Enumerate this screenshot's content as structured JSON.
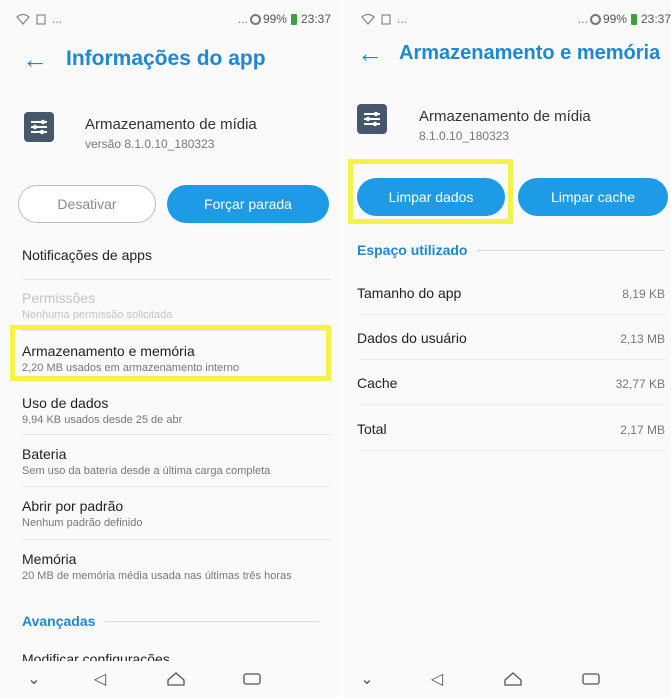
{
  "left": {
    "status": {
      "dots": "...",
      "time": "23:37",
      "battery": "99%"
    },
    "title": "Informações do app",
    "app_name": "Armazenamento de mídia",
    "app_version": "versão 8.1.0.10_180323",
    "buttons": {
      "disable": "Desativar",
      "force_stop": "Forçar parada"
    },
    "items": [
      {
        "title": "Notificações de apps",
        "sub": ""
      },
      {
        "title": "Permissões",
        "sub": "Nenhuma permissão solicitada"
      },
      {
        "title": "Armazenamento e memória",
        "sub": "2,20 MB usados em armazenamento interno"
      },
      {
        "title": "Uso de dados",
        "sub": "9,94 KB usados desde 25 de abr"
      },
      {
        "title": "Bateria",
        "sub": "Sem uso da bateria desde a última carga completa"
      },
      {
        "title": "Abrir por padrão",
        "sub": "Nenhum padrão definido"
      },
      {
        "title": "Memória",
        "sub": "20 MB de memória média usada nas últimas três horas"
      }
    ],
    "advanced_section": "Avançadas",
    "modify_settings": "Modificar configurações"
  },
  "right": {
    "status": {
      "dots": "...",
      "time": "23:37",
      "battery": "99%"
    },
    "title": "Armazenamento e memória",
    "app_name": "Armazenamento de mídia",
    "app_version": "8.1.0.10_180323",
    "buttons": {
      "clear_data": "Limpar dados",
      "clear_cache": "Limpar cache"
    },
    "section": "Espaço utilizado",
    "rows": [
      {
        "label": "Tamanho do app",
        "value": "8,19 KB"
      },
      {
        "label": "Dados do usuário",
        "value": "2,13 MB"
      },
      {
        "label": "Cache",
        "value": "32,77 KB"
      },
      {
        "label": "Total",
        "value": "2,17 MB"
      }
    ]
  },
  "colors": {
    "accent": "#1e88d6",
    "button": "#1e9be6",
    "highlight": "#f5f24a",
    "app_icon": "#46566b"
  }
}
